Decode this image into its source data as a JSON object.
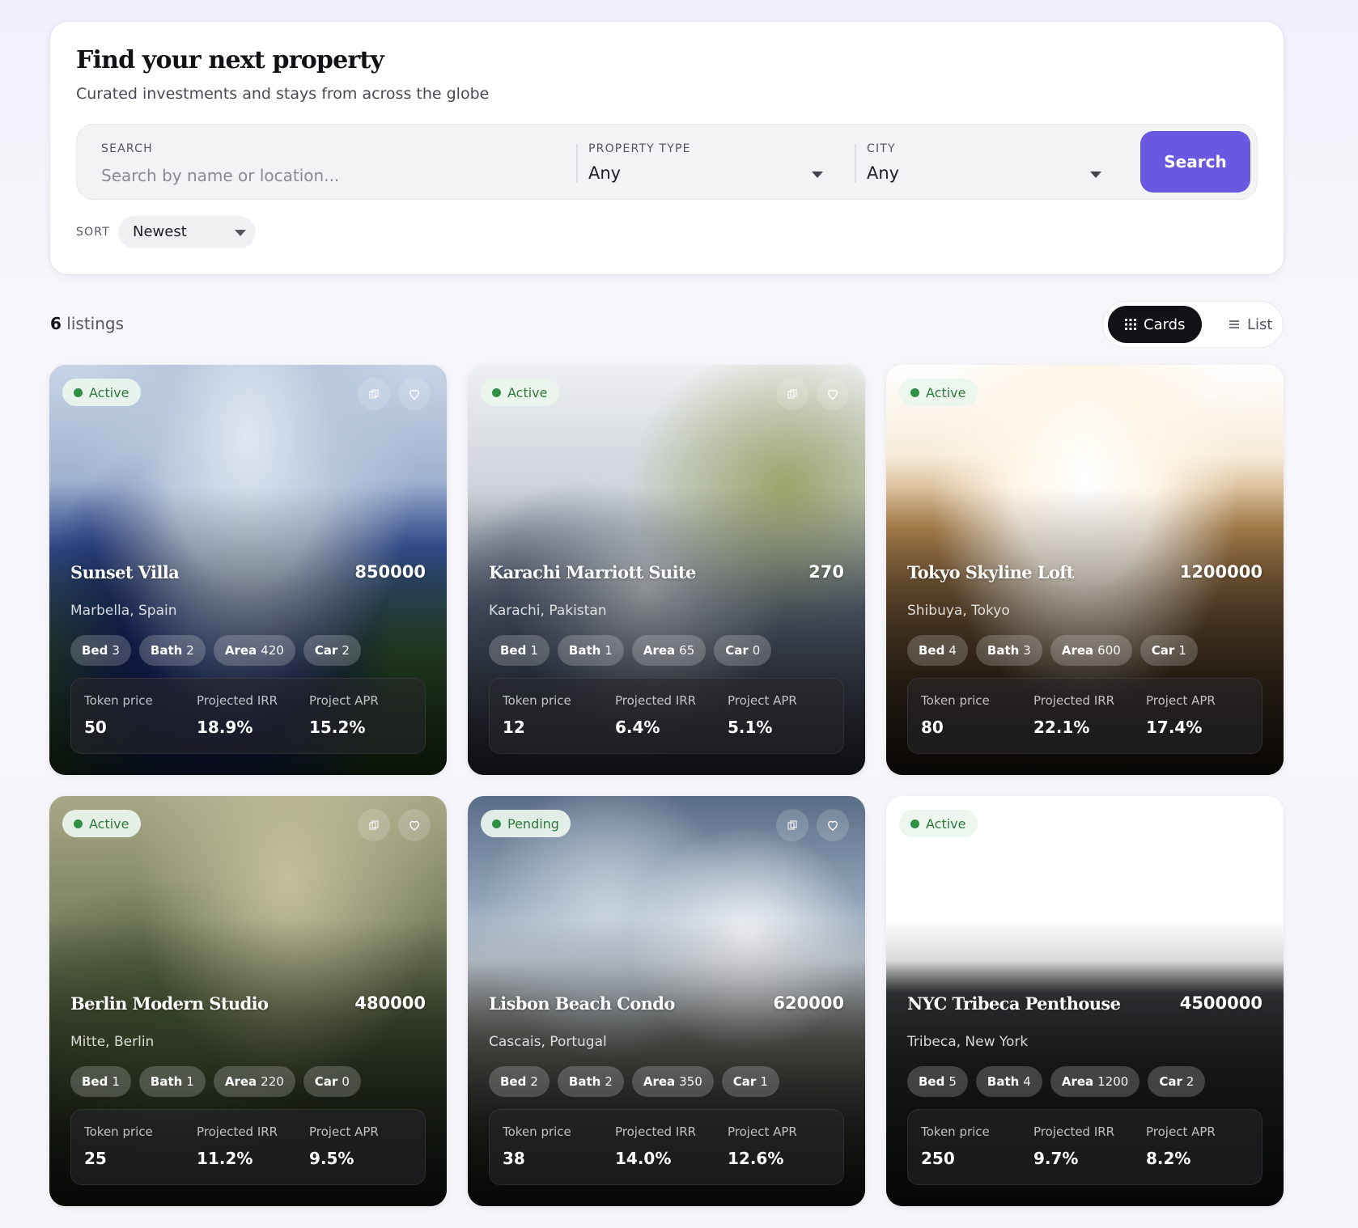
{
  "header": {
    "title": "Find your next property",
    "subtitle": "Curated investments and stays from across the globe"
  },
  "search": {
    "search_label": "SEARCH",
    "search_placeholder": "Search by name or location...",
    "type_label": "PROPERTY TYPE",
    "type_value": "Any",
    "city_label": "CITY",
    "city_value": "Any",
    "button_label": "Search",
    "sort_label": "SORT",
    "sort_value": "Newest"
  },
  "results": {
    "count": "6",
    "count_suffix": "listings"
  },
  "view_toggle": {
    "cards_label": "Cards",
    "list_label": "List",
    "active": "cards"
  },
  "metric_labels": {
    "token": "Token price",
    "irr": "Projected IRR",
    "apr": "Project APR"
  },
  "chip_labels": {
    "bed": "Bed",
    "bath": "Bath",
    "area": "Area",
    "car": "Car"
  },
  "listings": [
    {
      "status": "Active",
      "title": "Sunset Villa",
      "price": "850000",
      "location": "Marbella, Spain",
      "bed": "3",
      "bath": "2",
      "area": "420",
      "car": "2",
      "token": "50",
      "irr": "18.9%",
      "apr": "15.2%"
    },
    {
      "status": "Active",
      "title": "Karachi Marriott Suite",
      "price": "270",
      "location": "Karachi, Pakistan",
      "bed": "1",
      "bath": "1",
      "area": "65",
      "car": "0",
      "token": "12",
      "irr": "6.4%",
      "apr": "5.1%"
    },
    {
      "status": "Active",
      "title": "Tokyo Skyline Loft",
      "price": "1200000",
      "location": "Shibuya, Tokyo",
      "bed": "4",
      "bath": "3",
      "area": "600",
      "car": "1",
      "token": "80",
      "irr": "22.1%",
      "apr": "17.4%"
    },
    {
      "status": "Active",
      "title": "Berlin Modern Studio",
      "price": "480000",
      "location": "Mitte, Berlin",
      "bed": "1",
      "bath": "1",
      "area": "220",
      "car": "0",
      "token": "25",
      "irr": "11.2%",
      "apr": "9.5%"
    },
    {
      "status": "Pending",
      "title": "Lisbon Beach Condo",
      "price": "620000",
      "location": "Cascais, Portugal",
      "bed": "2",
      "bath": "2",
      "area": "350",
      "car": "1",
      "token": "38",
      "irr": "14.0%",
      "apr": "12.6%"
    },
    {
      "status": "Active",
      "title": "NYC Tribeca Penthouse",
      "price": "4500000",
      "location": "Tribeca, New York",
      "bed": "5",
      "bath": "4",
      "area": "1200",
      "car": "2",
      "token": "250",
      "irr": "9.7%",
      "apr": "8.2%"
    }
  ],
  "colors": {
    "accent": "#6a59e0",
    "status_active_text": "#2e7a3d",
    "status_dot": "#2f8f45",
    "toggle_active_bg": "#121216"
  },
  "icons": {
    "status": "status-dot",
    "share": "share-icon",
    "favorite": "heart-icon",
    "cards": "grid-icon",
    "list": "list-icon",
    "dropdown": "chevron-down-icon"
  }
}
